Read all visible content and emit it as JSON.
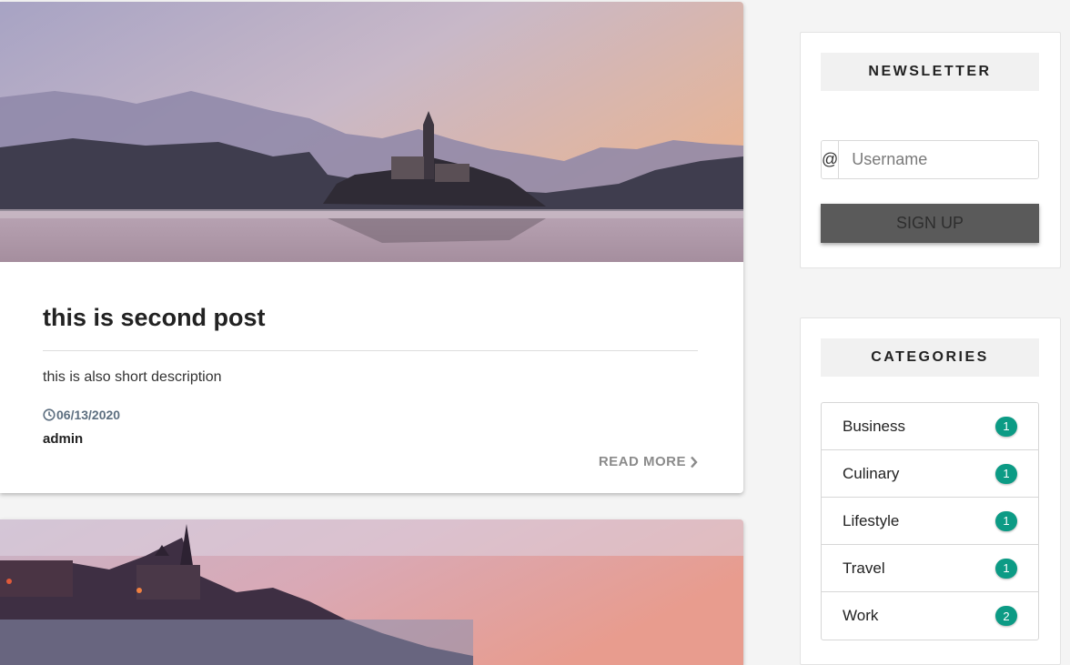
{
  "post": {
    "title": "this is second post",
    "description": "this is also short description",
    "date": "06/13/2020",
    "author": "admin",
    "read_more": "READ MORE"
  },
  "newsletter": {
    "title": "NEWSLETTER",
    "input_addon": "@",
    "input_placeholder": "Username",
    "signup_label": "SIGN UP"
  },
  "categories": {
    "title": "CATEGORIES",
    "items": [
      {
        "label": "Business",
        "count": "1"
      },
      {
        "label": "Culinary",
        "count": "1"
      },
      {
        "label": "Lifestyle",
        "count": "1"
      },
      {
        "label": "Travel",
        "count": "1"
      },
      {
        "label": "Work",
        "count": "2"
      }
    ]
  },
  "colors": {
    "badge": "#0c9b85",
    "signup_button": "#5a5a5a",
    "date_text": "#5d6f80",
    "page_background": "#f4f4f4"
  },
  "icons": {
    "date": "clock-icon",
    "read_more": "chevron-right-icon",
    "input_addon": "at-sign-icon"
  }
}
